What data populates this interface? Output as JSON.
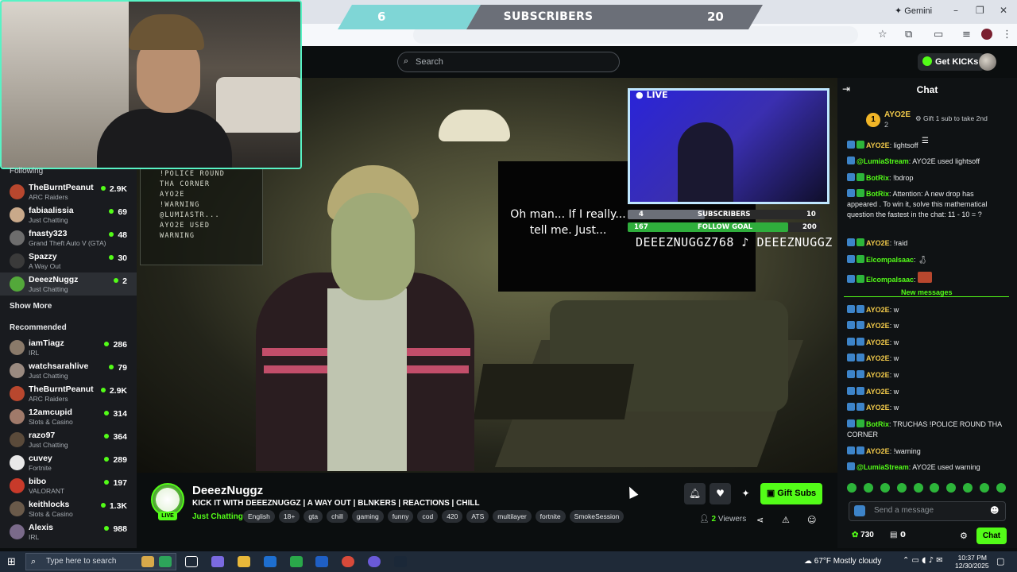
{
  "overlay": {
    "left_count": "6",
    "label": "SUBSCRIBERS",
    "right_count": "20",
    "left_color": "#7fd6d6",
    "label_color": "#6b6f78"
  },
  "browser": {
    "gemini_label": "Gemini"
  },
  "header": {
    "search_placeholder": "Search",
    "get_kicks_label": "Get KICKs"
  },
  "sidebar": {
    "following_label": "Following",
    "following": [
      {
        "name": "TheBurntPeanut",
        "category": "ARC Raiders",
        "viewers": "2.9K",
        "avatar_color": "#b8472e"
      },
      {
        "name": "fabiaalissia",
        "category": "Just Chatting",
        "viewers": "69",
        "avatar_color": "#c9a98a"
      },
      {
        "name": "fnasty323",
        "category": "Grand Theft Auto V (GTA)",
        "viewers": "48",
        "avatar_color": "#6d6d6d"
      },
      {
        "name": "Spazzy",
        "category": "A Way Out",
        "viewers": "30",
        "avatar_color": "#3a3a3a"
      },
      {
        "name": "DeeezNuggz",
        "category": "Just Chatting",
        "viewers": "2",
        "avatar_color": "#53a83a",
        "active": true
      }
    ],
    "show_more_label": "Show More",
    "recommended_label": "Recommended",
    "recommended": [
      {
        "name": "iamTiagz",
        "category": "IRL",
        "viewers": "286",
        "avatar_color": "#8a7a6a"
      },
      {
        "name": "watchsarahlive",
        "category": "Just Chatting",
        "viewers": "79",
        "avatar_color": "#9a8a80"
      },
      {
        "name": "TheBurntPeanut",
        "category": "ARC Raiders",
        "viewers": "2.9K",
        "avatar_color": "#b8472e"
      },
      {
        "name": "12amcupid",
        "category": "Slots & Casino",
        "viewers": "314",
        "avatar_color": "#a07a6a"
      },
      {
        "name": "razo97",
        "category": "Just Chatting",
        "viewers": "364",
        "avatar_color": "#5a4a3a"
      },
      {
        "name": "cuvey",
        "category": "Fortnite",
        "viewers": "289",
        "avatar_color": "#e8e8e8"
      },
      {
        "name": "bibo",
        "category": "VALORANT",
        "viewers": "197",
        "avatar_color": "#c83a2a"
      },
      {
        "name": "keithlocks",
        "category": "Slots & Casino",
        "viewers": "1.3K",
        "avatar_color": "#6a5a4a"
      },
      {
        "name": "Alexis",
        "category": "IRL",
        "viewers": "988",
        "avatar_color": "#7a6a8a"
      }
    ]
  },
  "video": {
    "overlay_message": "Oh man... If I really... tell me. Just...",
    "command_list": [
      "!POLICE ROUND",
      "THA CORNER",
      "AYO2E",
      "!WARNING",
      "@LUMIASTR...",
      "AYO2E USED",
      "WARNING"
    ],
    "collab_live": "LIVE",
    "collab_goal1_left": "4",
    "collab_goal1_label": "SUBSCRIBERS",
    "collab_goal1_right": "10",
    "collab_goal1_progress": 0.4,
    "collab_goal2_left": "167",
    "collab_goal2_label": "FOLLOW GOAL",
    "collab_goal2_right": "200",
    "collab_goal2_progress": 0.835,
    "socials_text": "DEEEZNUGGZ768 ♪ DEEEZNUGGZ"
  },
  "stream": {
    "streamer": "DeeezNuggz",
    "live_badge": "LIVE",
    "title": "KICK IT WITH DEEEZNUGGZ | A WAY OUT | BLNKERS | REACTIONS | CHILL",
    "category": "Just Chatting",
    "tags": [
      "English",
      "18+",
      "gta",
      "chill",
      "gaming",
      "funny",
      "cod",
      "420",
      "ATS",
      "multilayer",
      "fortnite",
      "SmokeSession"
    ],
    "gift_label": "Gift Subs",
    "viewers_count": "2",
    "viewers_label": "Viewers"
  },
  "chat": {
    "title": "Chat",
    "pinned_rank": "1",
    "pinned_name": "AYO2E",
    "pinned_count": "2",
    "pinned_note": "Gift 1 sub to take 2nd",
    "messages_before": [
      {
        "user": "AYO2E",
        "text": ": lightsoff",
        "color": "#f1c94a"
      },
      {
        "user": "@LumiaStream",
        "text": ": AYO2E used lightsoff",
        "color": "#53fc18"
      },
      {
        "user": "BotRix",
        "text": ": !bdrop",
        "color": "#53fc18"
      },
      {
        "user": "BotRix",
        "text": ": Attention: A new drop has appeared . To win it, solve this mathematical question the fastest in the chat: 11 - 10 = ?",
        "color": "#53fc18"
      },
      {
        "user": "AYO2E",
        "text": ": !raid",
        "color": "#f1c94a"
      },
      {
        "user": "Elcompalsaac",
        "text": ":",
        "color": "#53fc18"
      },
      {
        "user": "Elcompalsaac",
        "text": ":",
        "color": "#53fc18"
      }
    ],
    "new_messages_label": "New messages",
    "messages_after": [
      {
        "user": "AYO2E",
        "text": ": w",
        "color": "#f1c94a"
      },
      {
        "user": "AYO2E",
        "text": ": w",
        "color": "#f1c94a"
      },
      {
        "user": "AYO2E",
        "text": ": w",
        "color": "#f1c94a"
      },
      {
        "user": "AYO2E",
        "text": ": w",
        "color": "#f1c94a"
      },
      {
        "user": "AYO2E",
        "text": ": w",
        "color": "#f1c94a"
      },
      {
        "user": "AYO2E",
        "text": ": w",
        "color": "#f1c94a"
      },
      {
        "user": "AYO2E",
        "text": ": w",
        "color": "#f1c94a"
      },
      {
        "user": "BotRix",
        "text": ": TRUCHAS !POLICE ROUND THA CORNER",
        "color": "#53fc18"
      },
      {
        "user": "AYO2E",
        "text": ": !warning",
        "color": "#f1c94a"
      },
      {
        "user": "@LumiaStream",
        "text": ": AYO2E used warning",
        "color": "#53fc18"
      }
    ],
    "input_placeholder": "Send a message",
    "kicks_count": "730",
    "sub_count": "0",
    "send_label": "Chat"
  },
  "taskbar": {
    "search_placeholder": "Type here to search",
    "weather": "67°F  Mostly cloudy",
    "time": "10:37 PM",
    "date": "12/30/2025"
  }
}
